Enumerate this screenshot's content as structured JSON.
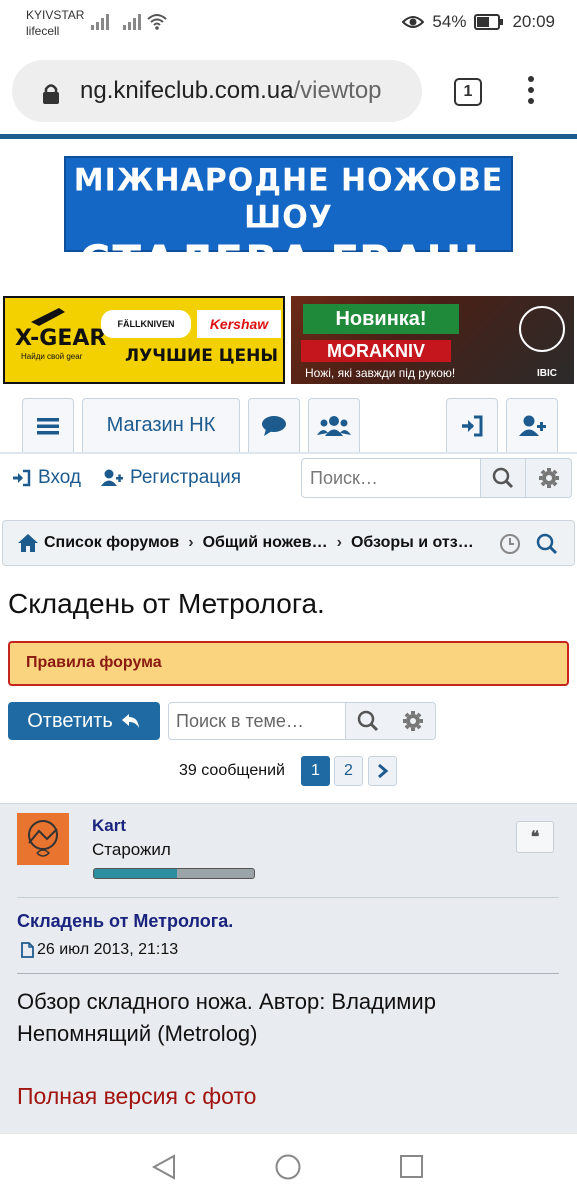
{
  "status_bar": {
    "carrier1": "KYIVSTAR",
    "carrier2": "lifecell",
    "battery": "54%",
    "time": "20:09"
  },
  "browser": {
    "url_domain": "ng.knifeclub.com.ua",
    "url_path": "/viewtop",
    "tab_count": "1"
  },
  "banners": {
    "main_line1": "МІЖНАРОДНЕ НОЖОВЕ ШОУ",
    "main_line2": "СТАЛЕВА ГРАНЬ",
    "left_ad": {
      "xgear": "X-GEAR",
      "xgear_sub": "Найди свой gear",
      "brand1": "FÄLLKNIVEN",
      "brand2": "Kershaw",
      "prices": "ЛУЧШИЕ ЦЕНЫ"
    },
    "right_ad": {
      "novinka": "Новинка!",
      "brand": "MORAKNIV",
      "slogan": "Ножі, які завжди під рукою!",
      "logo_text": "IBIC"
    }
  },
  "nav": {
    "shop_label": "Магазин НК"
  },
  "login": {
    "login_label": "Вход",
    "register_label": "Регистрация",
    "search_placeholder": "Поиск…"
  },
  "breadcrumb": {
    "items": [
      "Список форумов",
      "Общий ножев…",
      "Обзоры и отз…"
    ]
  },
  "topic": {
    "title": "Складень от Метролога.",
    "rules_label": "Правила форума",
    "reply_label": "Ответить",
    "search_placeholder": "Поиск в теме…",
    "message_count": "39 сообщений",
    "pages": [
      "1",
      "2"
    ],
    "current_page": 1
  },
  "post": {
    "username": "Kart",
    "rank": "Старожил",
    "reputation_fraction": 0.52,
    "title": "Складень от Метролога.",
    "date": "26 июл 2013, 21:13",
    "body": "Обзор складного ножа. Автор: Владимир Непомнящий (Metrolog)",
    "link_text": "Полная версия с фото"
  },
  "colors": {
    "accent": "#1d5b8f",
    "button": "#1f6aa3",
    "rules_bg": "#fad47e",
    "rules_border": "#c4251c",
    "link_red": "#a1140f"
  }
}
